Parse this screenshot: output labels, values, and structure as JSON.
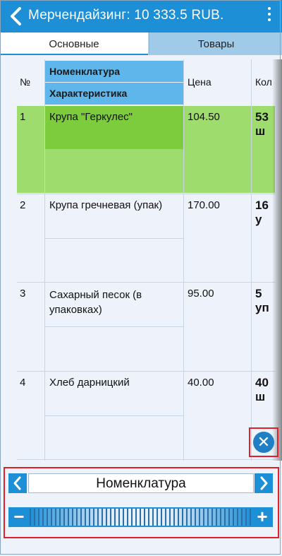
{
  "header": {
    "title": "Мерчендайзинг: 10 333.5 RUB."
  },
  "tabs": [
    {
      "label": "Основные"
    },
    {
      "label": "Товары"
    }
  ],
  "table": {
    "columns": {
      "num": "№",
      "nomenclature": "Номенклатура",
      "characteristic": "Характеристика",
      "price": "Цена",
      "qty": "Кол"
    },
    "rows": [
      {
        "num": "1",
        "name": "Крупа \"Геркулес\"",
        "price": "104.50",
        "qty": "53 ш"
      },
      {
        "num": "2",
        "name": "Крупа гречневая (упак)",
        "price": "170.00",
        "qty": "16 у"
      },
      {
        "num": "3",
        "name": "Сахарный песок (в упаковках)",
        "price": "95.00",
        "qty": "5 уп"
      },
      {
        "num": "4",
        "name": "Хлеб дарницкий",
        "price": "40.00",
        "qty": "40 ш"
      }
    ]
  },
  "navigator": {
    "field": "Номенклатура"
  },
  "icons": {
    "back": "back-icon",
    "menu": "menu-icon",
    "close": "close-icon",
    "prev": "chevron-left-icon",
    "next": "chevron-right-icon",
    "minus": "minus-icon",
    "plus": "plus-icon"
  },
  "colors": {
    "accent": "#1d8fd6",
    "header_cell": "#5eb6ea",
    "selected_row": "#9edc6e",
    "selected_cell": "#7ccc3e",
    "highlight": "#e0202a"
  }
}
